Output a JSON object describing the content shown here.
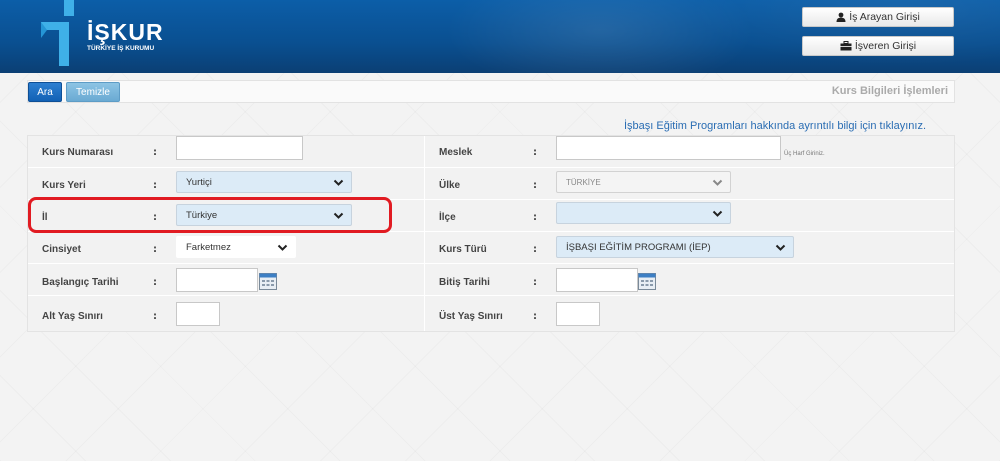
{
  "header": {
    "brand": "İŞKUR",
    "subtitle": "TÜRKİYE İŞ KURUMU",
    "job_seeker_login": "İş Arayan Girişi",
    "employer_login": "İşveren Girişi"
  },
  "toolbar": {
    "search_button": "Ara",
    "clear_button": "Temizle",
    "page_title": "Kurs Bilgileri İşlemleri"
  },
  "info_link": "İşbaşı Eğitim Programları hakkında ayrıntılı bilgi için tıklayınız.",
  "form": {
    "colon": ":",
    "course_number": {
      "label": "Kurs Numarası",
      "value": ""
    },
    "profession": {
      "label": "Meslek",
      "value": "",
      "hint": "Üç Harf Giriniz."
    },
    "course_location": {
      "label": "Kurs Yeri",
      "selected": "Yurtiçi"
    },
    "country": {
      "label": "Ülke",
      "selected": "TÜRKİYE"
    },
    "province": {
      "label": "İl",
      "selected": "Türkiye"
    },
    "district": {
      "label": "İlçe",
      "selected": ""
    },
    "gender": {
      "label": "Cinsiyet",
      "selected": "Farketmez"
    },
    "course_type": {
      "label": "Kurs Türü",
      "selected": "İŞBAŞI EĞİTİM PROGRAMI (İEP)"
    },
    "start_date": {
      "label": "Başlangıç Tarihi",
      "value": ""
    },
    "end_date": {
      "label": "Bitiş Tarihi",
      "value": ""
    },
    "min_age": {
      "label": "Alt Yaş Sınırı",
      "value": ""
    },
    "max_age": {
      "label": "Üst Yaş Sınırı",
      "value": ""
    }
  },
  "colors": {
    "header_blue": "#0c5ea8",
    "primary_button": "#1a6cc4",
    "secondary_button": "#78b4dc",
    "link": "#2a6db3",
    "highlight_red": "#e11b22"
  },
  "icons": [
    "user-icon",
    "briefcase-icon",
    "chevron-down-icon",
    "calendar-icon"
  ]
}
